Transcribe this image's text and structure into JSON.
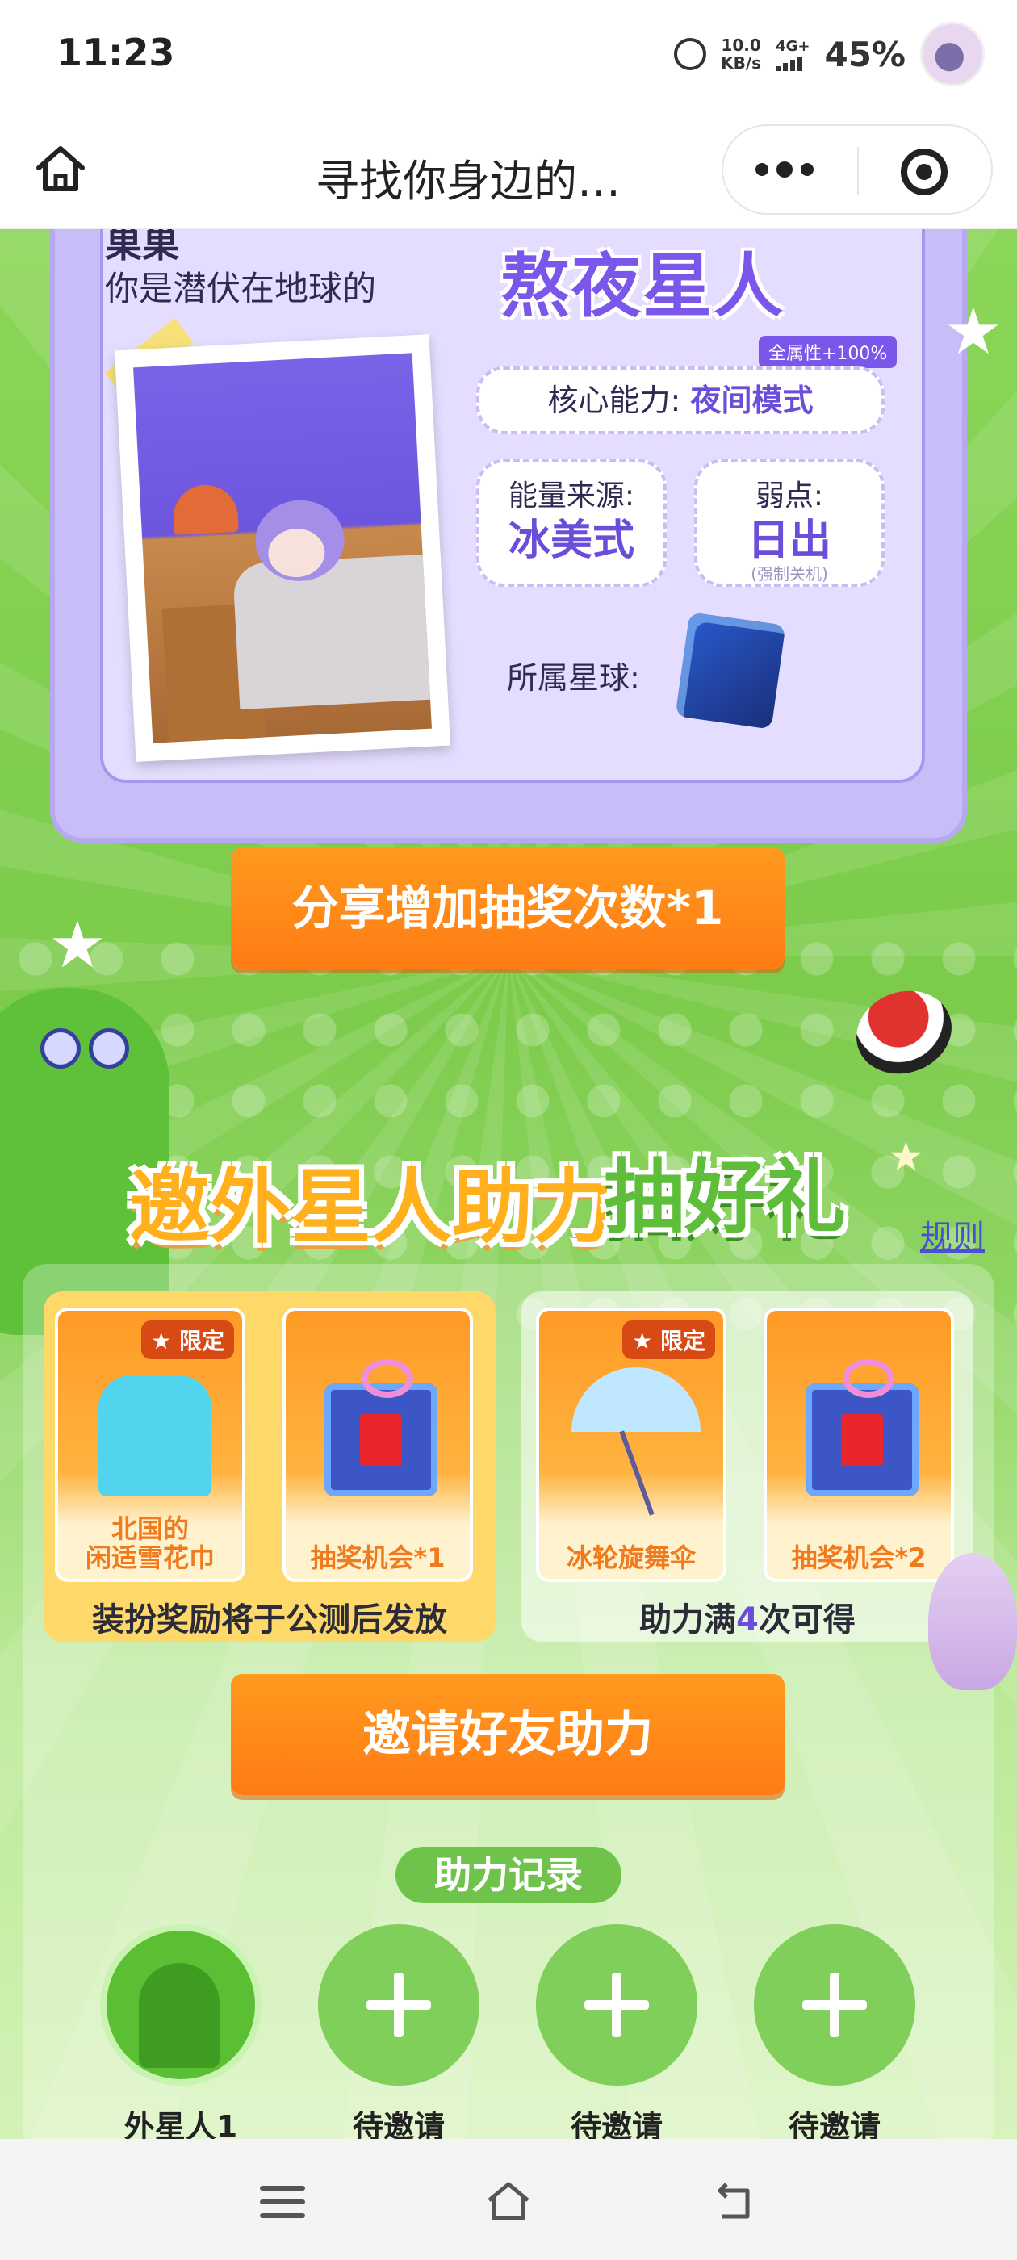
{
  "status_bar": {
    "time": "11:23",
    "net_speed_value": "10.0",
    "net_speed_unit": "KB/s",
    "network": "4G+",
    "battery": "45%",
    "icons": [
      "alarm-icon",
      "signal-icon",
      "avatar"
    ]
  },
  "nav": {
    "title": "寻找你身边的…",
    "home_icon": "home-icon",
    "more_icon": "more-dots-icon",
    "close_icon": "target-close-icon"
  },
  "character_card": {
    "name": "巣巣",
    "subtitle": "你是潜伏在地球的",
    "big_title": "熬夜星人",
    "attribute_badge": "全属性+100%",
    "core_label": "核心能力:",
    "core_value": "夜间模式",
    "energy_label": "能量来源:",
    "energy_value": "冰美式",
    "weakness_label": "弱点:",
    "weakness_value": "日出",
    "weakness_note": "(强制关机)",
    "planet_label": "所属星球:"
  },
  "share_button": "分享增加抽奖次数*1",
  "invite_section": {
    "title_part1": "邀外星人助力",
    "title_part2": "抽好礼",
    "rules_link": "规则",
    "groups": [
      {
        "caption": "装扮奖励将于公测后发放",
        "cards": [
          {
            "badge": "限定",
            "label_line1": "北国的",
            "label_line2": "闲适雪花巾"
          },
          {
            "label_line1": "抽奖机会*1"
          }
        ]
      },
      {
        "caption_prefix": "助力满",
        "caption_num": "4",
        "caption_suffix": "次可得",
        "cards": [
          {
            "badge": "限定",
            "label_line1": "冰轮旋舞伞"
          },
          {
            "label_line1": "抽奖机会*2"
          }
        ]
      }
    ],
    "invite_button": "邀请好友助力"
  },
  "records": {
    "title": "助力记录",
    "slots": [
      {
        "label": "外星人1",
        "filled": true
      },
      {
        "label": "待邀请",
        "filled": false
      },
      {
        "label": "待邀请",
        "filled": false
      },
      {
        "label": "待邀请",
        "filled": false
      }
    ]
  },
  "colors": {
    "accent_orange": "#ff8a1a",
    "accent_purple": "#7a57ea",
    "accent_green": "#6fc24a",
    "card_bg": "#e5ddff"
  }
}
